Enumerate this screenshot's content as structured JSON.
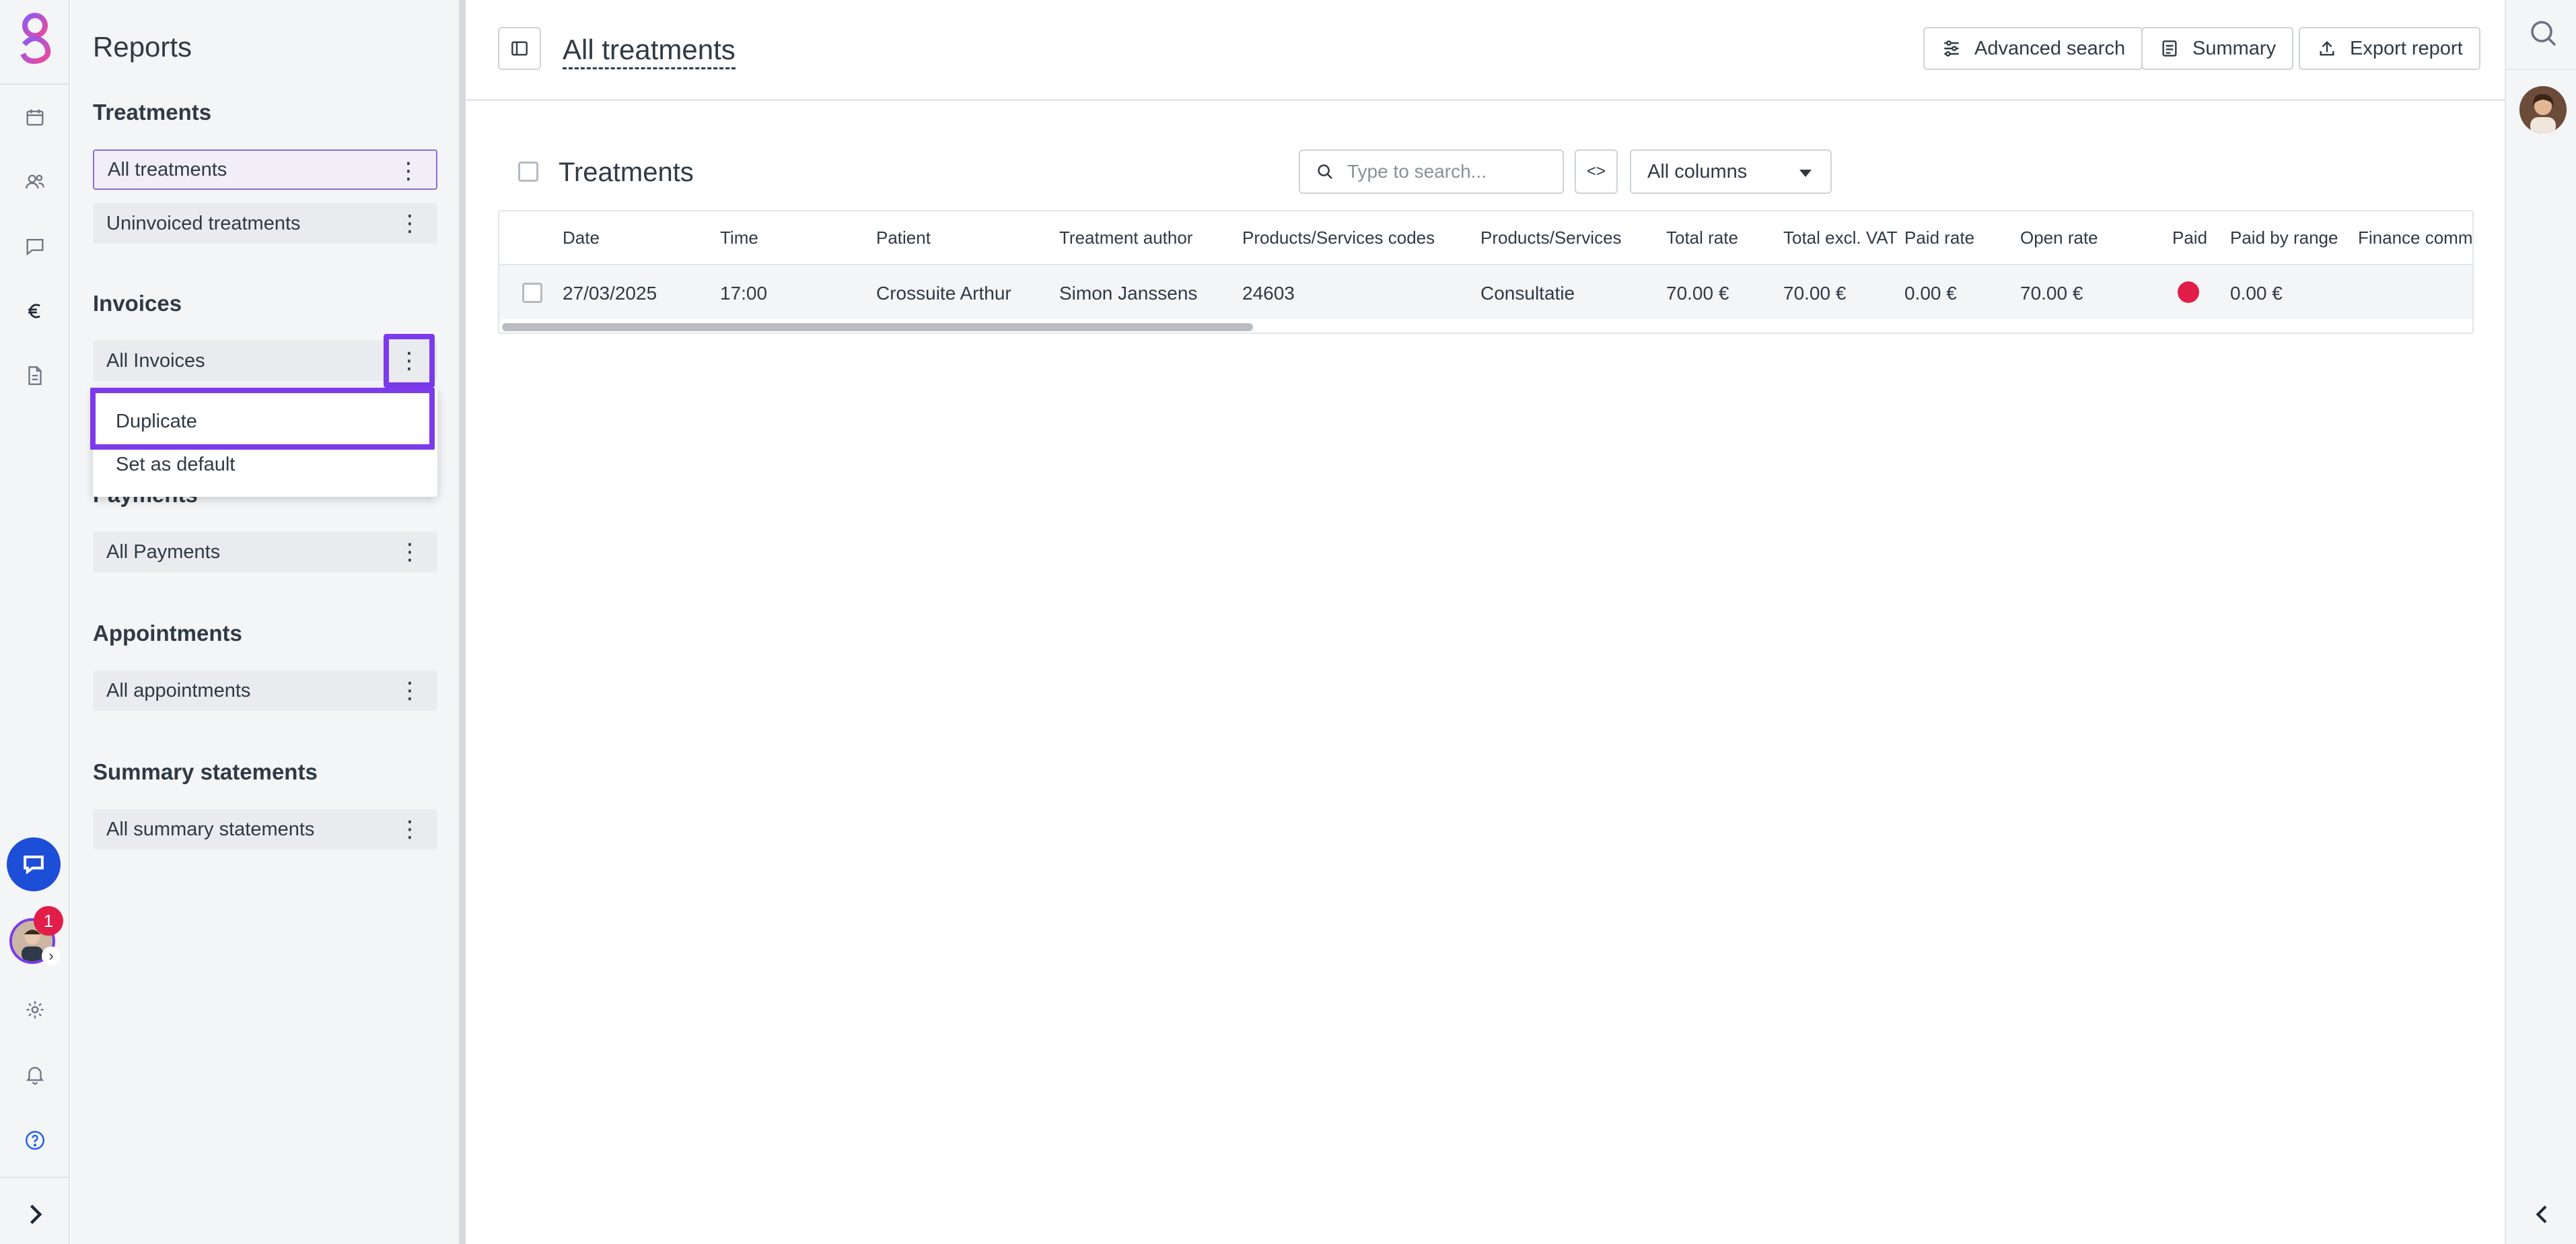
{
  "sidebar": {
    "title": "Reports",
    "sections": [
      {
        "heading": "Treatments",
        "items": [
          "All treatments",
          "Uninvoiced treatments"
        ]
      },
      {
        "heading": "Invoices",
        "items": [
          "All Invoices"
        ]
      },
      {
        "heading": "Payments",
        "items": [
          "All Payments"
        ]
      },
      {
        "heading": "Appointments",
        "items": [
          "All appointments"
        ]
      },
      {
        "heading": "Summary statements",
        "items": [
          "All summary statements"
        ]
      }
    ],
    "kebab": "⋮"
  },
  "context_menu": {
    "items": [
      "Duplicate",
      "Set as default"
    ]
  },
  "rail": {
    "notification_count": "1",
    "icons": [
      "calendar-icon",
      "people-icon",
      "chat-icon",
      "euro-icon",
      "document-icon",
      "settings-icon",
      "bell-icon",
      "help-icon"
    ]
  },
  "header": {
    "title": "All treatments",
    "buttons": {
      "advanced_search": "Advanced search",
      "summary": "Summary",
      "export": "Export report"
    }
  },
  "panel": {
    "title": "Treatments",
    "search_placeholder": "Type to search...",
    "code_toggle": "<>",
    "columns_select": "All columns"
  },
  "table": {
    "columns": [
      "Date",
      "Time",
      "Patient",
      "Treatment author",
      "Products/Services codes",
      "Products/Services",
      "Total rate",
      "Total excl. VAT",
      "Paid rate",
      "Open rate",
      "Paid",
      "Paid by range",
      "Finance comm"
    ],
    "rows": [
      {
        "date": "27/03/2025",
        "time": "17:00",
        "patient": "Crossuite Arthur",
        "author": "Simon Janssens",
        "codes": "24603",
        "services": "Consultatie",
        "total_rate": "70.00 €",
        "total_excl_vat": "70.00 €",
        "paid_rate": "0.00 €",
        "open_rate": "70.00 €",
        "paid_status": "unpaid",
        "paid_by_range": "0.00 €",
        "finance_comment": ""
      }
    ]
  },
  "colors": {
    "accent": "#7c3aed",
    "paid_unpaid": "#e11d48",
    "chat": "#1d4ed8"
  }
}
